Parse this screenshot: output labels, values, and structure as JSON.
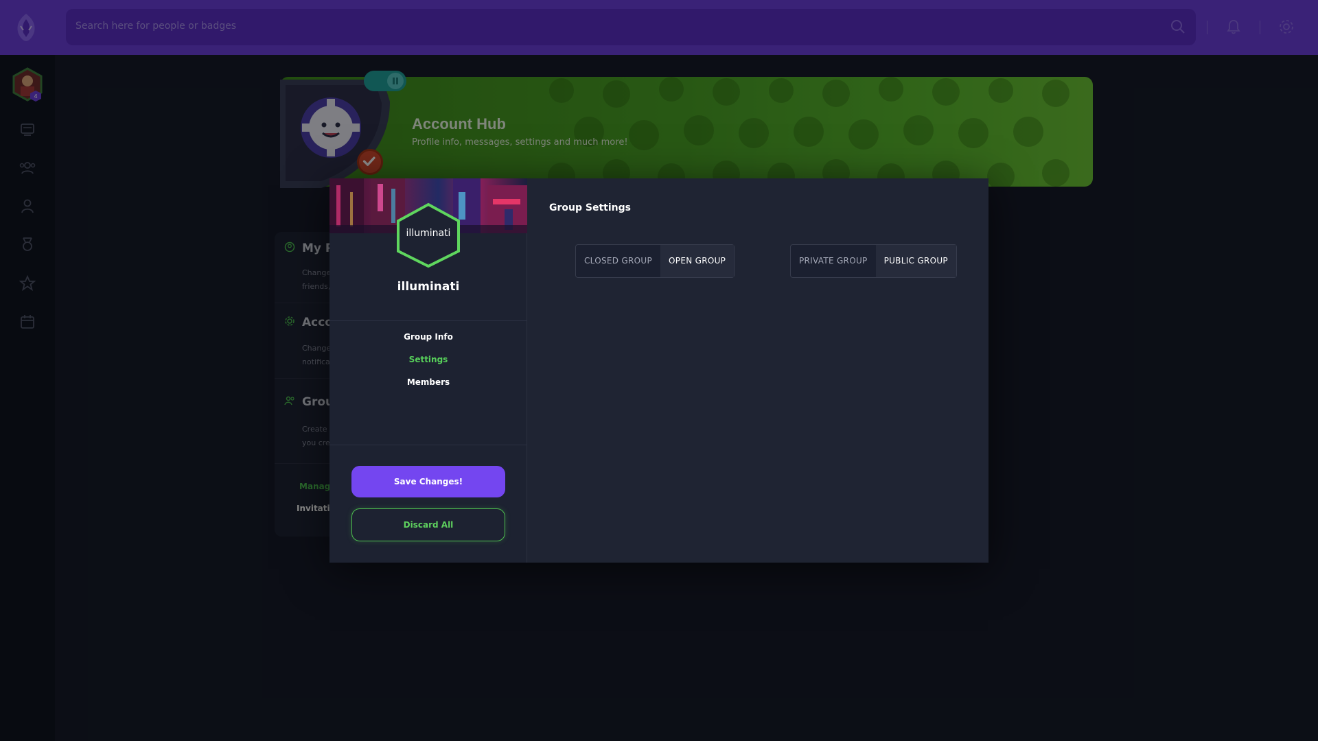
{
  "topbar": {
    "search_placeholder": "Search here for people or badges"
  },
  "sidebar": {
    "avatar_level": "4",
    "items": [
      "newsfeed-icon",
      "groups-icon",
      "members-icon",
      "badges-icon",
      "quests-icon",
      "events-icon"
    ]
  },
  "hero": {
    "title": "Account Hub",
    "subtitle": "Profile info, messages, settings and much more!"
  },
  "background_menu": {
    "sections": [
      {
        "title": "My P",
        "desc_line1": "Change",
        "desc_line2": "friends,"
      },
      {
        "title": "Acco",
        "desc_line1": "Change",
        "desc_line2": "notifica"
      },
      {
        "title": "Grou",
        "desc_line1": "Create",
        "desc_line2": "you cre"
      }
    ],
    "link_manage": "Manage",
    "link_invitations": "Invitatio"
  },
  "modal": {
    "hex_label": "illuminati",
    "group_name": "illuminati",
    "menu": [
      {
        "label": "Group Info",
        "active": false
      },
      {
        "label": "Settings",
        "active": true
      },
      {
        "label": "Members",
        "active": false
      }
    ],
    "save_label": "Save Changes!",
    "discard_label": "Discard All",
    "settings_title": "Group Settings",
    "access_toggle": {
      "options": [
        "CLOSED GROUP",
        "OPEN GROUP"
      ],
      "selected": "OPEN GROUP"
    },
    "visibility_toggle": {
      "options": [
        "PRIVATE GROUP",
        "PUBLIC GROUP"
      ],
      "selected": "PUBLIC GROUP"
    }
  },
  "colors": {
    "topbar": "#6a3fd9",
    "accent_purple": "#7446f0",
    "accent_green": "#57d05a",
    "modal_bg": "#1f2433"
  }
}
